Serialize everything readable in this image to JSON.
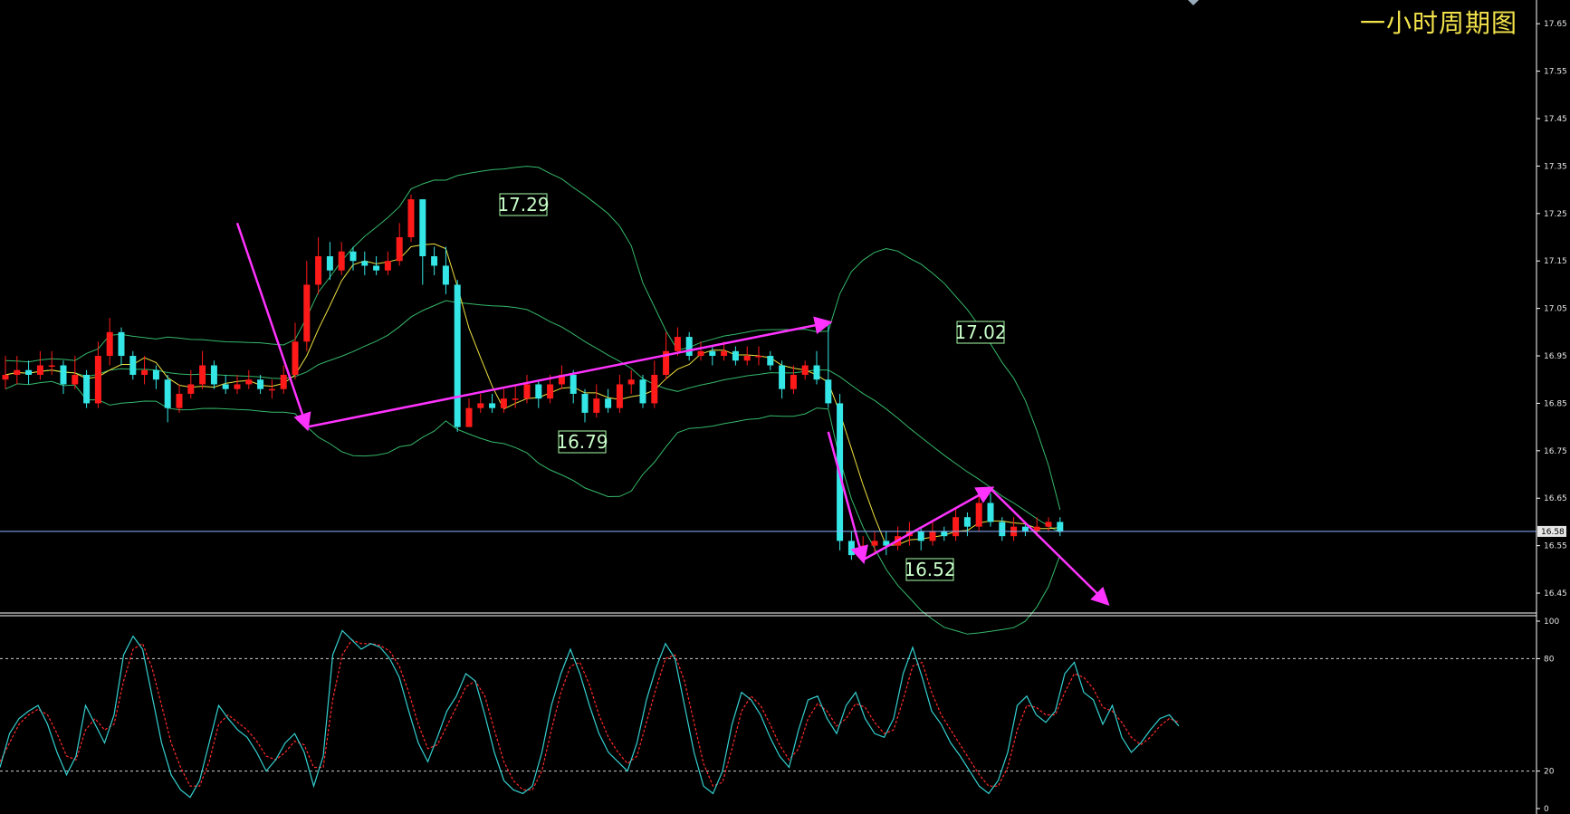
{
  "title": "一小时周期图",
  "colors": {
    "background": "#000000",
    "up_candle": "#ff1a1a",
    "down_candle": "#35e6e6",
    "band": "#35b86a",
    "ma_fast": "#f0e040",
    "arrow": "#ff33ff",
    "current_line": "#8ab4ff",
    "label_box": "#a8ffa8",
    "stoch_k": "#35d0d0",
    "stoch_d": "#ff2a2a",
    "title": "#f2e24b"
  },
  "chart_data": [
    {
      "type": "candlestick",
      "title": "一小时周期图",
      "y_ticks": [
        "17.65",
        "17.55",
        "17.45",
        "17.35",
        "17.25",
        "17.15",
        "17.05",
        "16.95",
        "16.85",
        "16.75",
        "16.65",
        "16.55",
        "16.45"
      ],
      "ylim": [
        16.41,
        17.7
      ],
      "current_price": "16.58",
      "labels": [
        {
          "text": "17.29",
          "price": 17.29
        },
        {
          "text": "16.79",
          "price": 16.79
        },
        {
          "text": "17.02",
          "price": 17.02
        },
        {
          "text": "16.52",
          "price": 16.52
        }
      ],
      "arrows_note_free": true,
      "arrows": [
        {
          "from": [
            20,
            17.23
          ],
          "to": [
            26,
            16.8
          ]
        },
        {
          "from": [
            26,
            16.8
          ],
          "to": [
            71,
            17.02
          ]
        },
        {
          "from": [
            71,
            16.79
          ],
          "to": [
            74,
            16.52
          ]
        },
        {
          "from": [
            74,
            16.52
          ],
          "to": [
            85,
            16.67
          ]
        },
        {
          "from": [
            85,
            16.67
          ],
          "to": [
            95,
            16.43
          ]
        }
      ],
      "candles": [
        [
          16.9,
          16.91,
          16.95,
          16.88
        ],
        [
          16.91,
          16.92,
          16.95,
          16.89
        ],
        [
          16.92,
          16.91,
          16.94,
          16.89
        ],
        [
          16.91,
          16.93,
          16.96,
          16.9
        ],
        [
          16.93,
          16.93,
          16.96,
          16.91
        ],
        [
          16.93,
          16.89,
          16.94,
          16.87
        ],
        [
          16.89,
          16.91,
          16.95,
          16.88
        ],
        [
          16.91,
          16.85,
          16.92,
          16.84
        ],
        [
          16.85,
          16.95,
          16.98,
          16.84
        ],
        [
          16.95,
          17.0,
          17.03,
          16.93
        ],
        [
          17.0,
          16.95,
          17.01,
          16.93
        ],
        [
          16.95,
          16.91,
          16.96,
          16.9
        ],
        [
          16.91,
          16.92,
          16.95,
          16.89
        ],
        [
          16.92,
          16.9,
          16.93,
          16.88
        ],
        [
          16.9,
          16.84,
          16.91,
          16.81
        ],
        [
          16.84,
          16.87,
          16.89,
          16.83
        ],
        [
          16.87,
          16.89,
          16.92,
          16.86
        ],
        [
          16.89,
          16.93,
          16.96,
          16.88
        ],
        [
          16.93,
          16.89,
          16.94,
          16.88
        ],
        [
          16.89,
          16.88,
          16.91,
          16.87
        ],
        [
          16.88,
          16.89,
          16.91,
          16.87
        ],
        [
          16.89,
          16.9,
          16.92,
          16.88
        ],
        [
          16.9,
          16.88,
          16.91,
          16.87
        ],
        [
          16.88,
          16.88,
          16.9,
          16.86
        ],
        [
          16.88,
          16.91,
          16.93,
          16.87
        ],
        [
          16.91,
          16.98,
          17.02,
          16.9
        ],
        [
          16.98,
          17.1,
          17.15,
          16.96
        ],
        [
          17.1,
          17.16,
          17.2,
          17.08
        ],
        [
          17.16,
          17.13,
          17.19,
          17.11
        ],
        [
          17.13,
          17.17,
          17.19,
          17.12
        ],
        [
          17.17,
          17.15,
          17.18,
          17.13
        ],
        [
          17.15,
          17.14,
          17.17,
          17.12
        ],
        [
          17.14,
          17.13,
          17.16,
          17.12
        ],
        [
          17.13,
          17.15,
          17.17,
          17.12
        ],
        [
          17.15,
          17.2,
          17.23,
          17.14
        ],
        [
          17.2,
          17.28,
          17.29,
          17.19
        ],
        [
          17.28,
          17.16,
          17.28,
          17.1
        ],
        [
          17.16,
          17.14,
          17.18,
          17.12
        ],
        [
          17.14,
          17.1,
          17.18,
          17.08
        ],
        [
          17.1,
          16.8,
          17.11,
          16.79
        ],
        [
          16.8,
          16.84,
          16.86,
          16.8
        ],
        [
          16.84,
          16.85,
          16.87,
          16.83
        ],
        [
          16.85,
          16.84,
          16.87,
          16.83
        ],
        [
          16.84,
          16.86,
          16.88,
          16.83
        ],
        [
          16.86,
          16.86,
          16.89,
          16.84
        ],
        [
          16.86,
          16.89,
          16.91,
          16.85
        ],
        [
          16.89,
          16.86,
          16.9,
          16.84
        ],
        [
          16.86,
          16.89,
          16.91,
          16.85
        ],
        [
          16.89,
          16.91,
          16.93,
          16.88
        ],
        [
          16.91,
          16.87,
          16.92,
          16.85
        ],
        [
          16.87,
          16.83,
          16.88,
          16.81
        ],
        [
          16.83,
          16.86,
          16.89,
          16.82
        ],
        [
          16.86,
          16.84,
          16.88,
          16.83
        ],
        [
          16.84,
          16.89,
          16.91,
          16.83
        ],
        [
          16.89,
          16.9,
          16.92,
          16.87
        ],
        [
          16.9,
          16.85,
          16.91,
          16.84
        ],
        [
          16.85,
          16.91,
          16.94,
          16.84
        ],
        [
          16.91,
          16.96,
          17.0,
          16.9
        ],
        [
          16.96,
          16.99,
          17.01,
          16.95
        ],
        [
          16.99,
          16.95,
          17.0,
          16.94
        ],
        [
          16.95,
          16.96,
          16.98,
          16.94
        ],
        [
          16.96,
          16.95,
          16.97,
          16.93
        ],
        [
          16.95,
          16.96,
          16.98,
          16.94
        ],
        [
          16.96,
          16.94,
          16.97,
          16.93
        ],
        [
          16.94,
          16.95,
          16.97,
          16.93
        ],
        [
          16.95,
          16.95,
          16.97,
          16.93
        ],
        [
          16.95,
          16.93,
          16.96,
          16.92
        ],
        [
          16.93,
          16.88,
          16.94,
          16.86
        ],
        [
          16.88,
          16.91,
          16.93,
          16.87
        ],
        [
          16.91,
          16.93,
          16.94,
          16.9
        ],
        [
          16.93,
          16.9,
          16.96,
          16.89
        ],
        [
          16.9,
          16.85,
          17.02,
          16.84
        ],
        [
          16.85,
          16.56,
          16.87,
          16.54
        ],
        [
          16.56,
          16.53,
          16.58,
          16.52
        ],
        [
          16.53,
          16.55,
          16.57,
          16.52
        ],
        [
          16.55,
          16.56,
          16.58,
          16.53
        ],
        [
          16.56,
          16.55,
          16.58,
          16.53
        ],
        [
          16.55,
          16.57,
          16.59,
          16.54
        ],
        [
          16.57,
          16.58,
          16.6,
          16.55
        ],
        [
          16.58,
          16.56,
          16.59,
          16.54
        ],
        [
          16.56,
          16.58,
          16.6,
          16.55
        ],
        [
          16.58,
          16.57,
          16.59,
          16.56
        ],
        [
          16.57,
          16.61,
          16.63,
          16.56
        ],
        [
          16.61,
          16.59,
          16.62,
          16.57
        ],
        [
          16.59,
          16.64,
          16.67,
          16.58
        ],
        [
          16.64,
          16.6,
          16.66,
          16.59
        ],
        [
          16.6,
          16.57,
          16.61,
          16.56
        ],
        [
          16.57,
          16.59,
          16.61,
          16.56
        ],
        [
          16.59,
          16.58,
          16.6,
          16.57
        ],
        [
          16.58,
          16.59,
          16.61,
          16.57
        ],
        [
          16.59,
          16.6,
          16.61,
          16.58
        ],
        [
          16.6,
          16.58,
          16.61,
          16.57
        ]
      ]
    },
    {
      "type": "line",
      "series": [
        {
          "values": []
        },
        {
          "values": []
        }
      ],
      "y_ticks": [
        "100",
        "80",
        "20",
        "0"
      ],
      "ylim": [
        0,
        100
      ],
      "levels": [
        80,
        20
      ],
      "k": [
        22,
        40,
        48,
        52,
        55,
        45,
        30,
        18,
        28,
        55,
        45,
        35,
        50,
        82,
        92,
        85,
        60,
        35,
        18,
        10,
        6,
        15,
        35,
        55,
        48,
        42,
        38,
        30,
        20,
        26,
        35,
        40,
        30,
        12,
        28,
        82,
        95,
        90,
        85,
        88,
        86,
        80,
        70,
        52,
        35,
        25,
        38,
        52,
        60,
        72,
        68,
        50,
        30,
        15,
        10,
        8,
        12,
        30,
        55,
        72,
        85,
        72,
        55,
        40,
        30,
        25,
        20,
        35,
        58,
        75,
        88,
        80,
        55,
        30,
        12,
        8,
        20,
        45,
        62,
        58,
        50,
        38,
        28,
        22,
        42,
        58,
        60,
        48,
        40,
        55,
        62,
        48,
        40,
        38,
        48,
        72,
        86,
        70,
        52,
        45,
        35,
        28,
        20,
        12,
        8,
        15,
        30,
        55,
        60,
        50,
        46,
        52,
        72,
        78,
        62,
        58,
        45,
        55,
        38,
        30,
        35,
        42,
        48,
        50,
        44
      ],
      "d": [
        25,
        35,
        45,
        50,
        53,
        50,
        40,
        28,
        26,
        42,
        48,
        42,
        45,
        68,
        85,
        88,
        75,
        55,
        35,
        22,
        12,
        12,
        25,
        45,
        50,
        46,
        42,
        36,
        28,
        26,
        30,
        36,
        34,
        22,
        22,
        58,
        82,
        90,
        88,
        88,
        87,
        84,
        76,
        62,
        45,
        32,
        34,
        44,
        54,
        65,
        68,
        60,
        42,
        25,
        15,
        10,
        10,
        20,
        42,
        62,
        76,
        78,
        66,
        50,
        38,
        30,
        24,
        28,
        46,
        64,
        80,
        82,
        68,
        46,
        24,
        12,
        14,
        32,
        52,
        60,
        55,
        45,
        34,
        26,
        32,
        48,
        56,
        52,
        44,
        48,
        56,
        54,
        46,
        40,
        42,
        58,
        76,
        78,
        62,
        50,
        42,
        34,
        26,
        18,
        12,
        12,
        22,
        42,
        55,
        54,
        50,
        50,
        62,
        72,
        70,
        64,
        54,
        52,
        46,
        38,
        34,
        38,
        44,
        48,
        46
      ]
    }
  ]
}
